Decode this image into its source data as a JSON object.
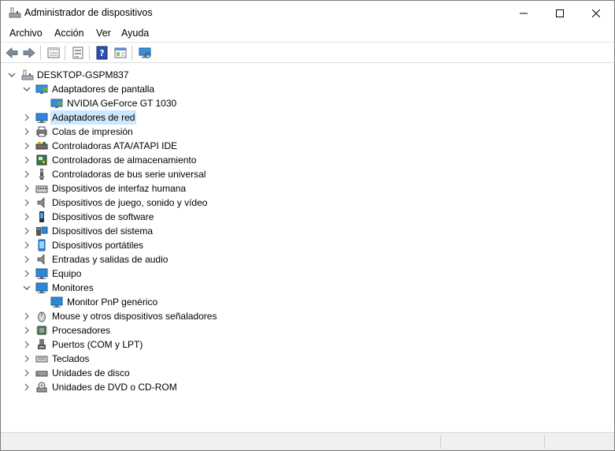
{
  "window": {
    "title": "Administrador de dispositivos"
  },
  "menu": [
    "Archivo",
    "Acción",
    "Ver",
    "Ayuda"
  ],
  "toolbar": {
    "icons": [
      "back-arrow-icon",
      "forward-arrow-icon",
      "properties-icon",
      "update-driver-icon",
      "help-icon",
      "view-icon",
      "scan-hardware-icon"
    ]
  },
  "tree": {
    "root": "DESKTOP-GSPM837",
    "items": [
      {
        "label": "Adaptadores de pantalla",
        "expanded": true,
        "children": [
          "NVIDIA GeForce GT 1030"
        ]
      },
      {
        "label": "Adaptadores de red",
        "expanded": false,
        "selected": true
      },
      {
        "label": "Colas de impresión",
        "expanded": false
      },
      {
        "label": "Controladoras ATA/ATAPI IDE",
        "expanded": false
      },
      {
        "label": "Controladoras de almacenamiento",
        "expanded": false
      },
      {
        "label": "Controladoras de bus serie universal",
        "expanded": false
      },
      {
        "label": "Dispositivos de interfaz humana",
        "expanded": false
      },
      {
        "label": "Dispositivos de juego, sonido y vídeo",
        "expanded": false
      },
      {
        "label": "Dispositivos de software",
        "expanded": false
      },
      {
        "label": "Dispositivos del sistema",
        "expanded": false
      },
      {
        "label": "Dispositivos portátiles",
        "expanded": false
      },
      {
        "label": "Entradas y salidas de audio",
        "expanded": false
      },
      {
        "label": "Equipo",
        "expanded": false
      },
      {
        "label": "Monitores",
        "expanded": true,
        "children": [
          "Monitor PnP genérico"
        ]
      },
      {
        "label": "Mouse y otros dispositivos señaladores",
        "expanded": false
      },
      {
        "label": "Procesadores",
        "expanded": false
      },
      {
        "label": "Puertos (COM y LPT)",
        "expanded": false
      },
      {
        "label": "Teclados",
        "expanded": false
      },
      {
        "label": "Unidades de disco",
        "expanded": false
      },
      {
        "label": "Unidades de DVD o CD-ROM",
        "expanded": false
      }
    ]
  },
  "colors": {
    "selection": "#cce8ff",
    "accent": "#0078d7"
  }
}
